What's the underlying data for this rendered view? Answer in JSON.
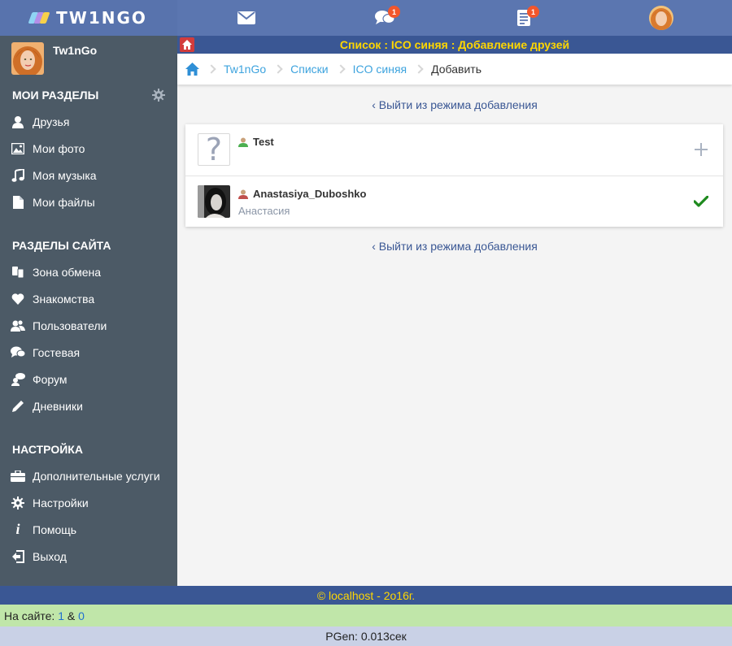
{
  "logo": {
    "text": "TW1NGO"
  },
  "topbar": {
    "messages_icon": "envelope-icon",
    "chat_badge": "1",
    "notifications_badge": "1"
  },
  "profile": {
    "name": "Tw1nGo"
  },
  "sidebar": {
    "sections": [
      {
        "title": "МОИ РАЗДЕЛЫ",
        "items": [
          {
            "label": "Друзья",
            "icon": "user-icon"
          },
          {
            "label": "Мои фото",
            "icon": "photo-icon"
          },
          {
            "label": "Моя музыка",
            "icon": "music-icon"
          },
          {
            "label": "Мои файлы",
            "icon": "file-icon"
          }
        ]
      },
      {
        "title": "РАЗДЕЛЫ САЙТА",
        "items": [
          {
            "label": "Зона обмена",
            "icon": "exchange-icon"
          },
          {
            "label": "Знакомства",
            "icon": "heart-icon"
          },
          {
            "label": "Пользователи",
            "icon": "users-icon"
          },
          {
            "label": "Гостевая",
            "icon": "chat-icon"
          },
          {
            "label": "Форум",
            "icon": "forum-icon"
          },
          {
            "label": "Дневники",
            "icon": "pencil-icon"
          }
        ]
      },
      {
        "title": "НАСТРОЙКА",
        "items": [
          {
            "label": "Дополнительные услуги",
            "icon": "briefcase-icon"
          },
          {
            "label": "Настройки",
            "icon": "gear-icon"
          },
          {
            "label": "Помощь",
            "icon": "info-icon"
          },
          {
            "label": "Выход",
            "icon": "logout-icon"
          }
        ]
      }
    ]
  },
  "title_bar": {
    "text": "Список : ICO синяя : Добавление друзей"
  },
  "breadcrumb": {
    "items": [
      "Tw1nGo",
      "Списки",
      "ICO синяя"
    ],
    "current": "Добавить"
  },
  "exit_link": "Выйти из режима добавления",
  "friends": [
    {
      "name": "Test",
      "subtitle": "",
      "action": "add"
    },
    {
      "name": "Anastasiya_Duboshko",
      "subtitle": "Анастасия",
      "action": "added"
    }
  ],
  "footer": {
    "text": "© localhost - 2o16г."
  },
  "online": {
    "label": "На сайте:",
    "count_users": "1",
    "amp": "&",
    "count_guests": "0"
  },
  "pgen": {
    "text": "PGen: 0.013сек"
  },
  "colors": {
    "topbar": "#5b76b0",
    "sidebar": "#4c5a66",
    "title_bar": "#3a5794",
    "title_text": "#ffd700",
    "breadcrumb_link": "#3da3de",
    "online_bar": "#c0e6a9",
    "pgen_bar": "#c9d1e6",
    "check": "#1e8a1e"
  }
}
